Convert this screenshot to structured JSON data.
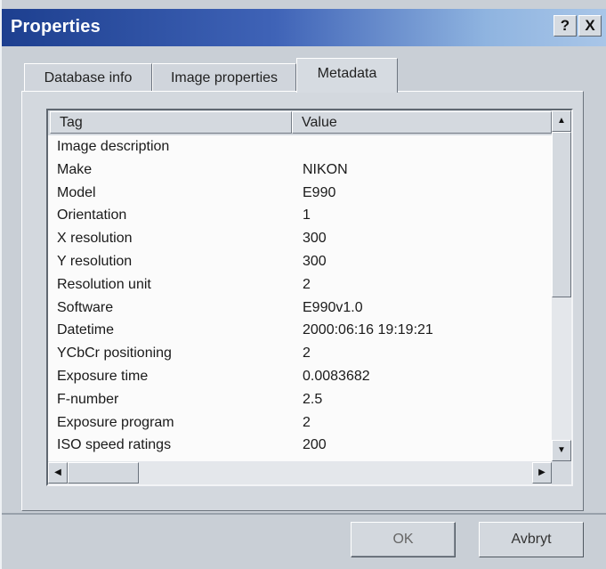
{
  "window": {
    "title": "Properties",
    "help_label": "?",
    "close_label": "X"
  },
  "tabs": [
    {
      "label": "Database info"
    },
    {
      "label": "Image properties"
    },
    {
      "label": "Metadata"
    }
  ],
  "table": {
    "columns": [
      "Tag",
      "Value"
    ],
    "rows": [
      {
        "tag": "Image description",
        "value": ""
      },
      {
        "tag": "Make",
        "value": "NIKON"
      },
      {
        "tag": "Model",
        "value": "E990"
      },
      {
        "tag": "Orientation",
        "value": "1"
      },
      {
        "tag": "X resolution",
        "value": "300"
      },
      {
        "tag": "Y resolution",
        "value": "300"
      },
      {
        "tag": "Resolution unit",
        "value": "2"
      },
      {
        "tag": "Software",
        "value": "E990v1.0"
      },
      {
        "tag": "Datetime",
        "value": "2000:06:16 19:19:21"
      },
      {
        "tag": "YCbCr positioning",
        "value": "2"
      },
      {
        "tag": "Exposure time",
        "value": "0.0083682"
      },
      {
        "tag": "F-number",
        "value": "2.5"
      },
      {
        "tag": "Exposure program",
        "value": "2"
      },
      {
        "tag": "ISO speed ratings",
        "value": "200"
      }
    ]
  },
  "buttons": {
    "ok": "OK",
    "cancel": "Avbryt"
  },
  "icons": {
    "scroll_up": "▲",
    "scroll_down": "▼",
    "scroll_left": "◀",
    "scroll_right": "▶"
  }
}
